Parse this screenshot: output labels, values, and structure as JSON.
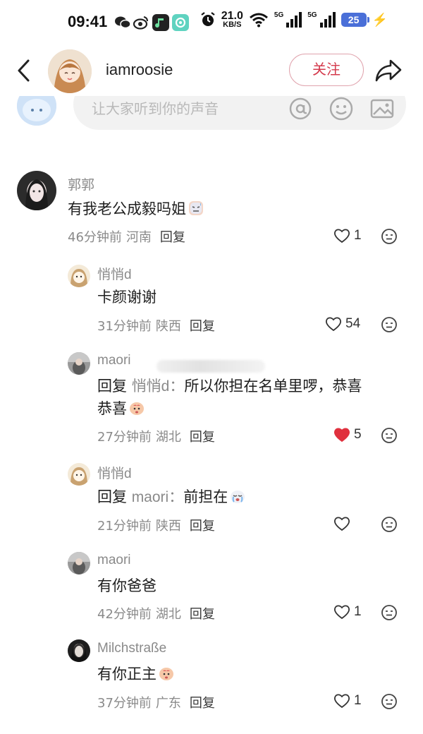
{
  "status_bar": {
    "time": "09:41",
    "net_speed": "21.0",
    "net_unit": "KB/S",
    "signal_label_1": "5G",
    "signal_label_2": "5G",
    "battery": "25"
  },
  "header": {
    "username": "iamroosie",
    "follow_label": "关注"
  },
  "comment_input": {
    "placeholder": "让大家听到你的声音"
  },
  "comments": [
    {
      "name": "郭郭",
      "text": "有我老公成毅吗姐",
      "time": "46分钟前",
      "location": "河南",
      "reply_label": "回复",
      "likes": "1"
    },
    {
      "name": "悄悄d",
      "text": "卡颜谢谢",
      "time": "31分钟前",
      "location": "陕西",
      "reply_label": "回复",
      "likes": "54"
    },
    {
      "name": "maori",
      "reply_prefix": "回复",
      "reply_target": "悄悄d：",
      "text_line1": "所以你担在名单里啰，恭喜",
      "text_line2": "恭喜",
      "time": "27分钟前",
      "location": "湖北",
      "reply_label": "回复",
      "likes": "5"
    },
    {
      "name": "悄悄d",
      "reply_prefix": "回复",
      "reply_target": "maori：",
      "text": "前担在",
      "time": "21分钟前",
      "location": "陕西",
      "reply_label": "回复",
      "likes": ""
    },
    {
      "name": "maori",
      "text": "有你爸爸",
      "time": "42分钟前",
      "location": "湖北",
      "reply_label": "回复",
      "likes": "1"
    },
    {
      "name": "Milchstraße",
      "text": "有你正主",
      "time": "37分钟前",
      "location": "广东",
      "reply_label": "回复",
      "likes": "1"
    }
  ],
  "colors": {
    "accent_red": "#d43a4c",
    "liked_red": "#e0313e",
    "meta_gray": "#8a8a8a"
  }
}
